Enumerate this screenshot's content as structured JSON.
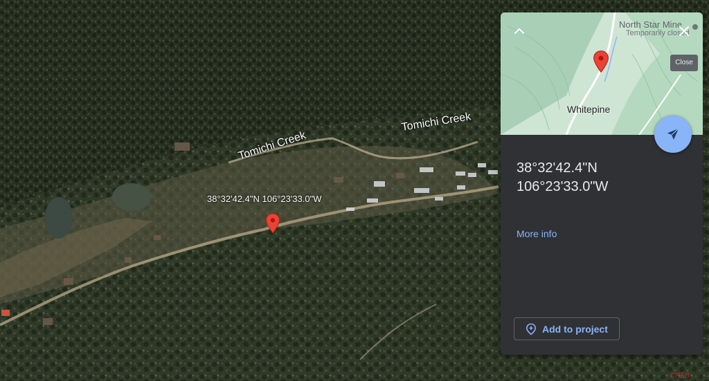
{
  "map": {
    "labels": {
      "creek_west": "Tomichi Creek",
      "creek_east": "Tomichi Creek",
      "coordinates": "38°32'42.4\"N 106°23'33.0\"W"
    }
  },
  "panel": {
    "thumbnail": {
      "poi_name": "North Star Mine",
      "poi_status": "Temporarily closed",
      "place_name": "Whitepine"
    },
    "close_tooltip": "Close",
    "latitude": "38°32'42.4\"N",
    "longitude": "106°23'33.0\"W",
    "more_info_label": "More info",
    "add_to_project_label": "Add to project"
  },
  "watermark": "CREB",
  "colors": {
    "panel_bg": "#303134",
    "link": "#8ab4f8",
    "pin": "#ea4335"
  }
}
